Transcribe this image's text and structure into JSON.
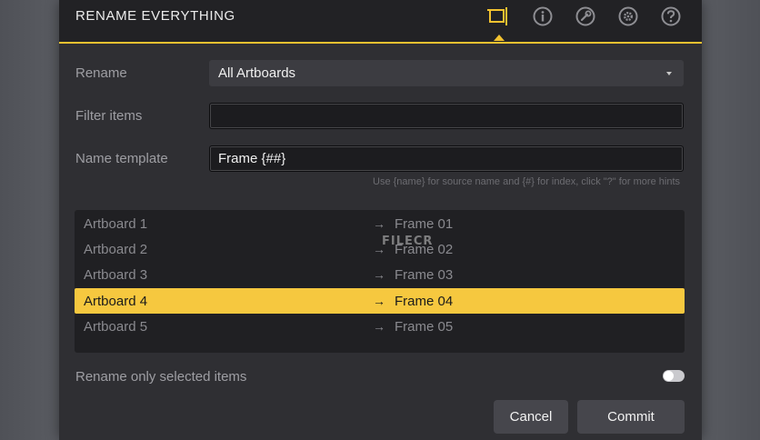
{
  "dialog": {
    "title": "RENAME EVERYTHING",
    "toolbar_icons": [
      "artboard-icon",
      "info-icon",
      "wrench-icon",
      "gear-icon",
      "help-icon"
    ],
    "active_tab": "artboard-icon"
  },
  "form": {
    "rename_label": "Rename",
    "rename_value": "All Artboards",
    "filter_label": "Filter items",
    "filter_value": "",
    "template_label": "Name template",
    "template_value": "Frame {##}",
    "hint": "Use {name} for source name and {#} for index, click \"?\" for more hints"
  },
  "list": {
    "rows": [
      {
        "source": "Artboard 1",
        "arrow": "→",
        "target": "Frame 01",
        "selected": false
      },
      {
        "source": "Artboard 2",
        "arrow": "→",
        "target": "Frame 02",
        "selected": false
      },
      {
        "source": "Artboard 3",
        "arrow": "→",
        "target": "Frame 03",
        "selected": false
      },
      {
        "source": "Artboard 4",
        "arrow": "→",
        "target": "Frame 04",
        "selected": true
      },
      {
        "source": "Artboard 5",
        "arrow": "→",
        "target": "Frame 05",
        "selected": false
      }
    ]
  },
  "options": {
    "selected_only_label": "Rename only selected items",
    "selected_only_on": false
  },
  "buttons": {
    "cancel": "Cancel",
    "commit": "Commit"
  },
  "watermark": "FILECR",
  "colors": {
    "accent": "#f6c83f",
    "dialog_bg": "#2f2f33",
    "header_bg": "#222225"
  }
}
